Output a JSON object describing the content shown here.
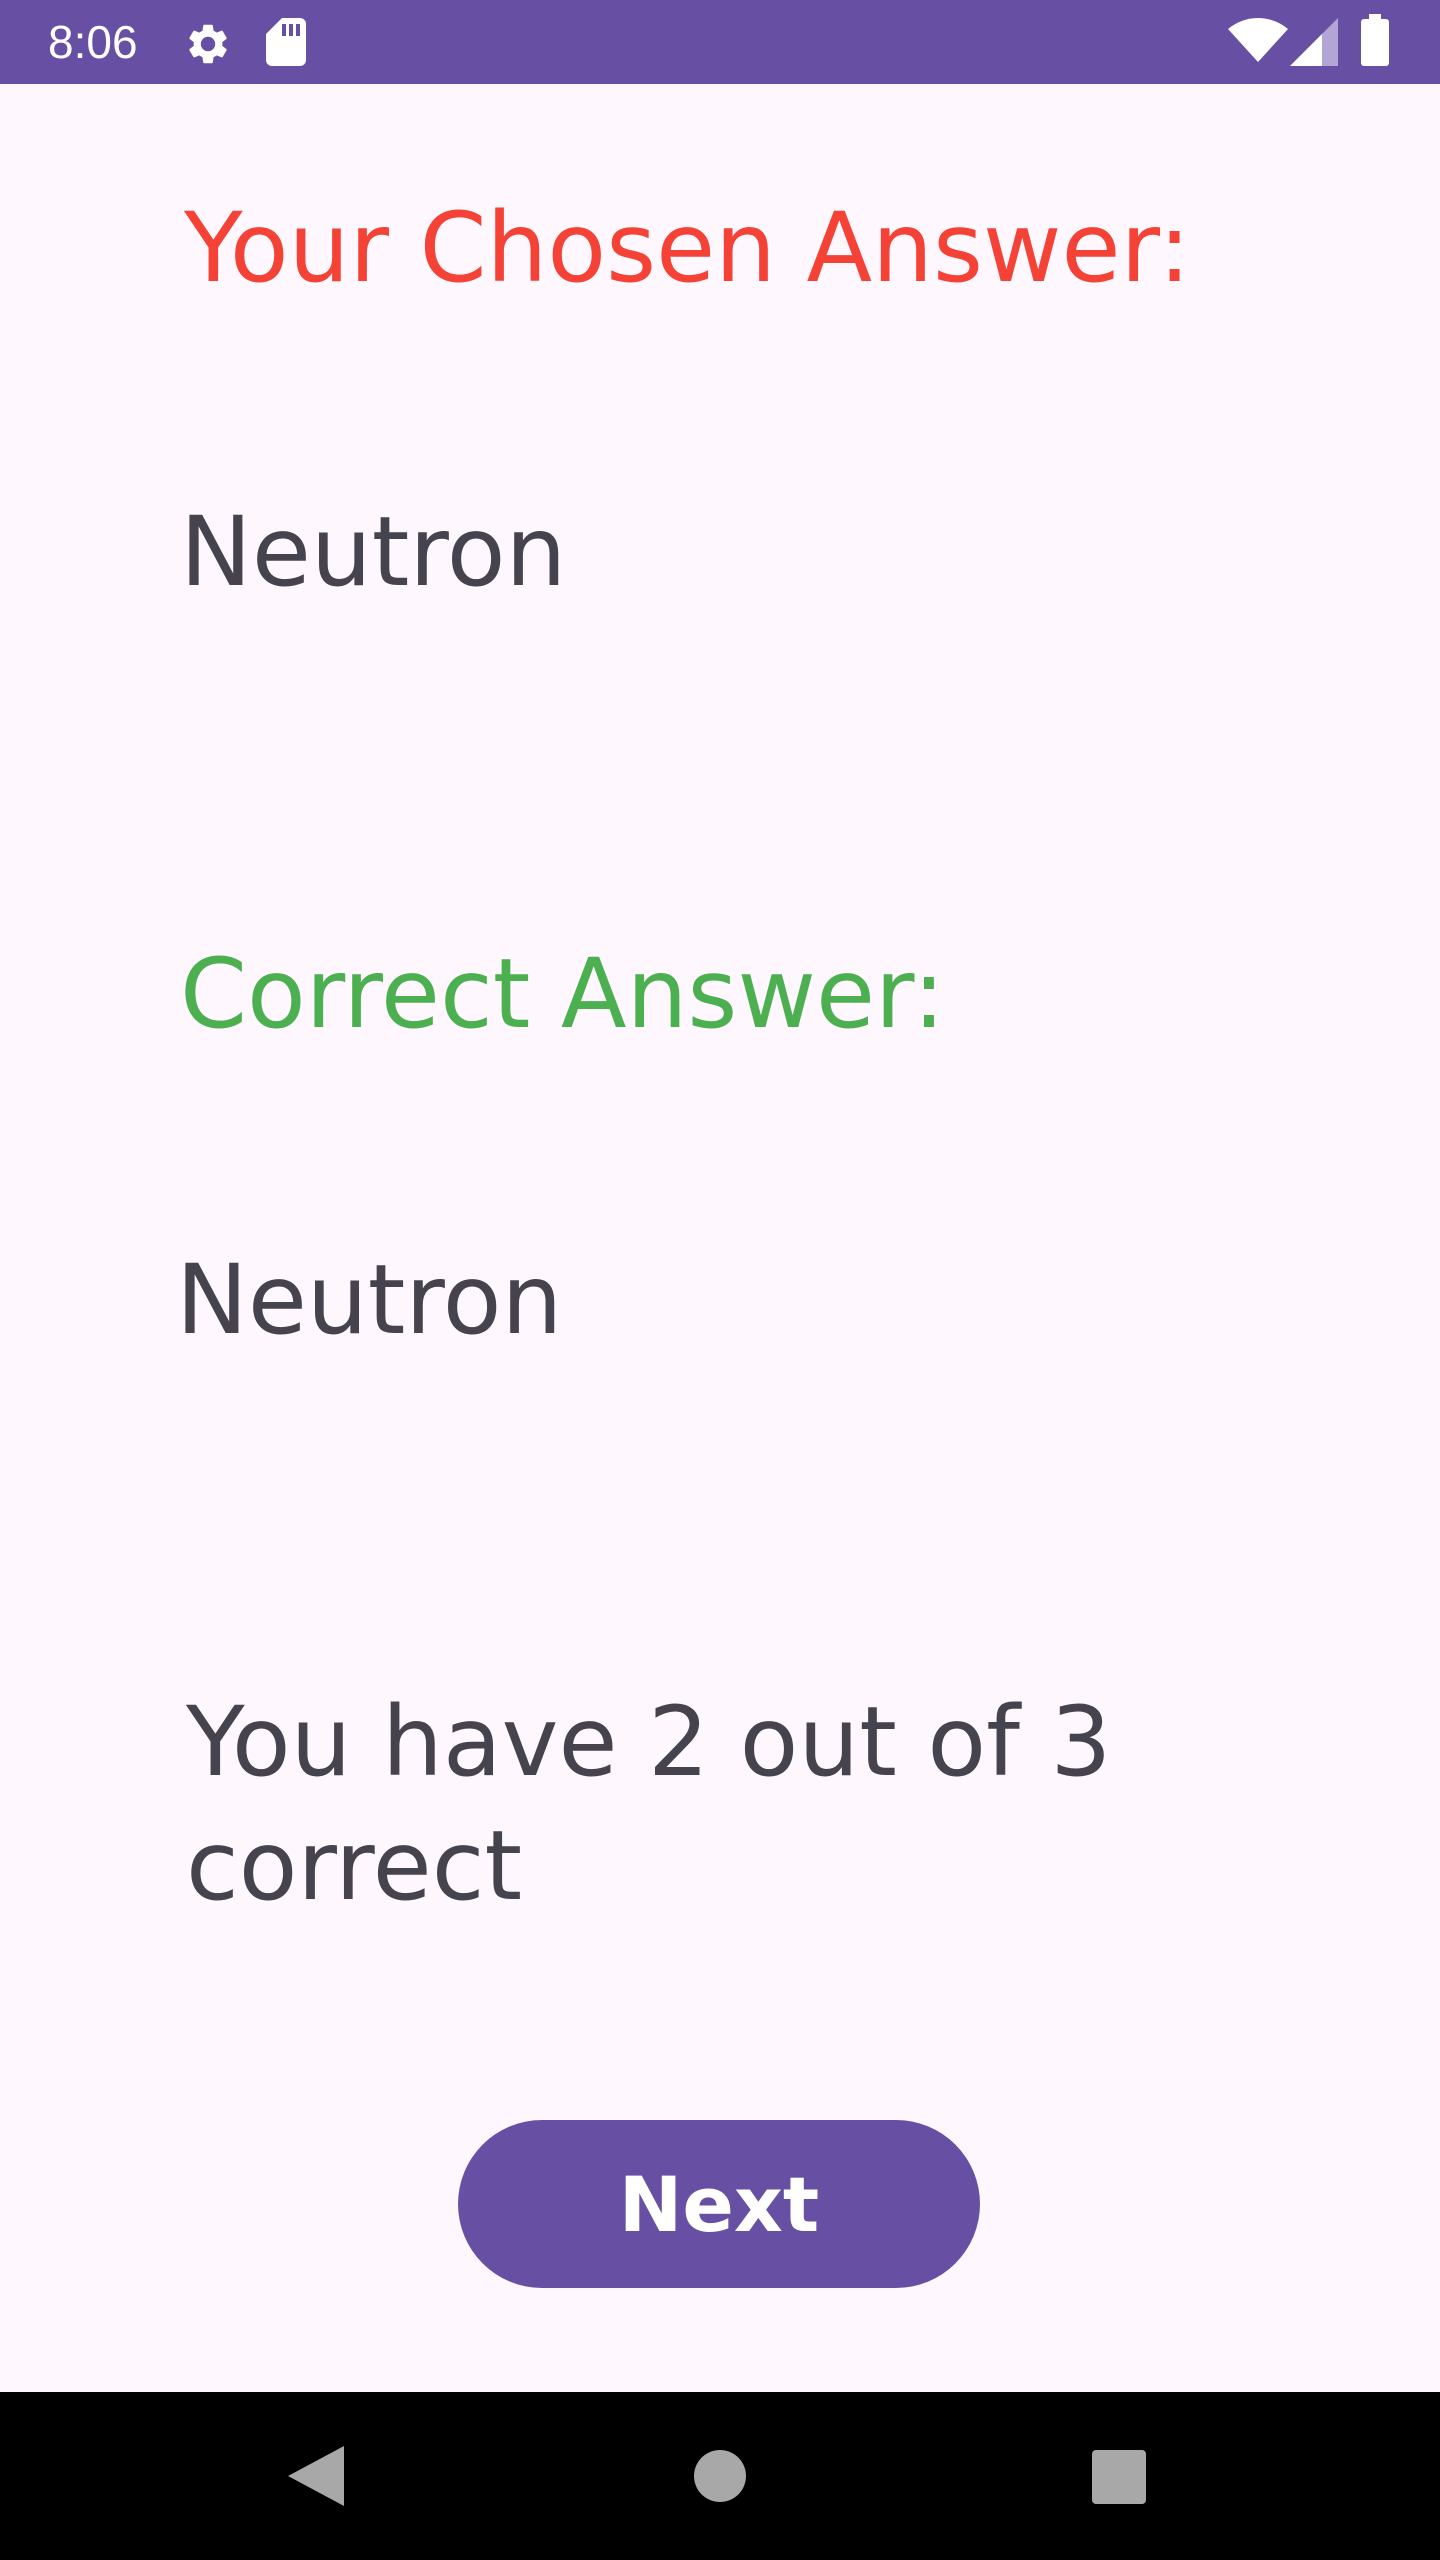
{
  "status_bar": {
    "time": "8:06",
    "background_color": "#6750A4",
    "icons": [
      "gear-icon",
      "sd-card-icon",
      "wifi-icon",
      "signal-icon",
      "battery-icon"
    ]
  },
  "result": {
    "chosen_label": "Your Chosen Answer:",
    "chosen_value": "Neutron",
    "correct_label": "Correct Answer:",
    "correct_value": "Neutron",
    "score_text": "You have 2 out of 3 correct",
    "chosen_label_color": "#F44336",
    "correct_label_color": "#4CAF50"
  },
  "actions": {
    "next_label": "Next",
    "button_color": "#6750A4"
  },
  "nav_bar": {
    "icons": [
      "back-icon",
      "home-icon",
      "recents-icon"
    ]
  }
}
